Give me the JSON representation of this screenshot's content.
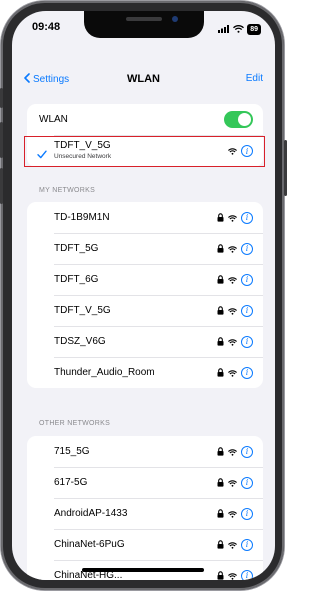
{
  "status_bar": {
    "time": "09:48",
    "battery": "89"
  },
  "nav": {
    "back_label": "Settings",
    "title": "WLAN",
    "edit_label": "Edit"
  },
  "wlan_toggle": {
    "label": "WLAN",
    "enabled": true
  },
  "connected": {
    "name": "TDFT_V_5G",
    "subtitle": "Unsecured Network",
    "locked": false
  },
  "my_networks": {
    "header": "MY NETWORKS",
    "items": [
      {
        "name": "TD-1B9M1N",
        "locked": true
      },
      {
        "name": "TDFT_5G",
        "locked": true
      },
      {
        "name": "TDFT_6G",
        "locked": true
      },
      {
        "name": "TDFT_V_5G",
        "locked": true
      },
      {
        "name": "TDSZ_V6G",
        "locked": true
      },
      {
        "name": "Thunder_Audio_Room",
        "locked": true
      }
    ]
  },
  "other_networks": {
    "header": "OTHER NETWORKS",
    "items": [
      {
        "name": "715_5G",
        "locked": true
      },
      {
        "name": "617-5G",
        "locked": true
      },
      {
        "name": "AndroidAP-1433",
        "locked": true
      },
      {
        "name": "ChinaNet-6PuG",
        "locked": true
      },
      {
        "name": "ChinaNet-HG...",
        "locked": true
      }
    ]
  },
  "icons": {
    "info": "info-icon",
    "wifi": "wifi-icon",
    "lock": "lock-icon",
    "checkmark": "checkmark-icon"
  },
  "colors": {
    "accent": "#0a7aff",
    "toggle_on": "#34c759",
    "highlight_border": "#d8202a",
    "background": "#f2f2f7"
  },
  "info_glyph": "i"
}
